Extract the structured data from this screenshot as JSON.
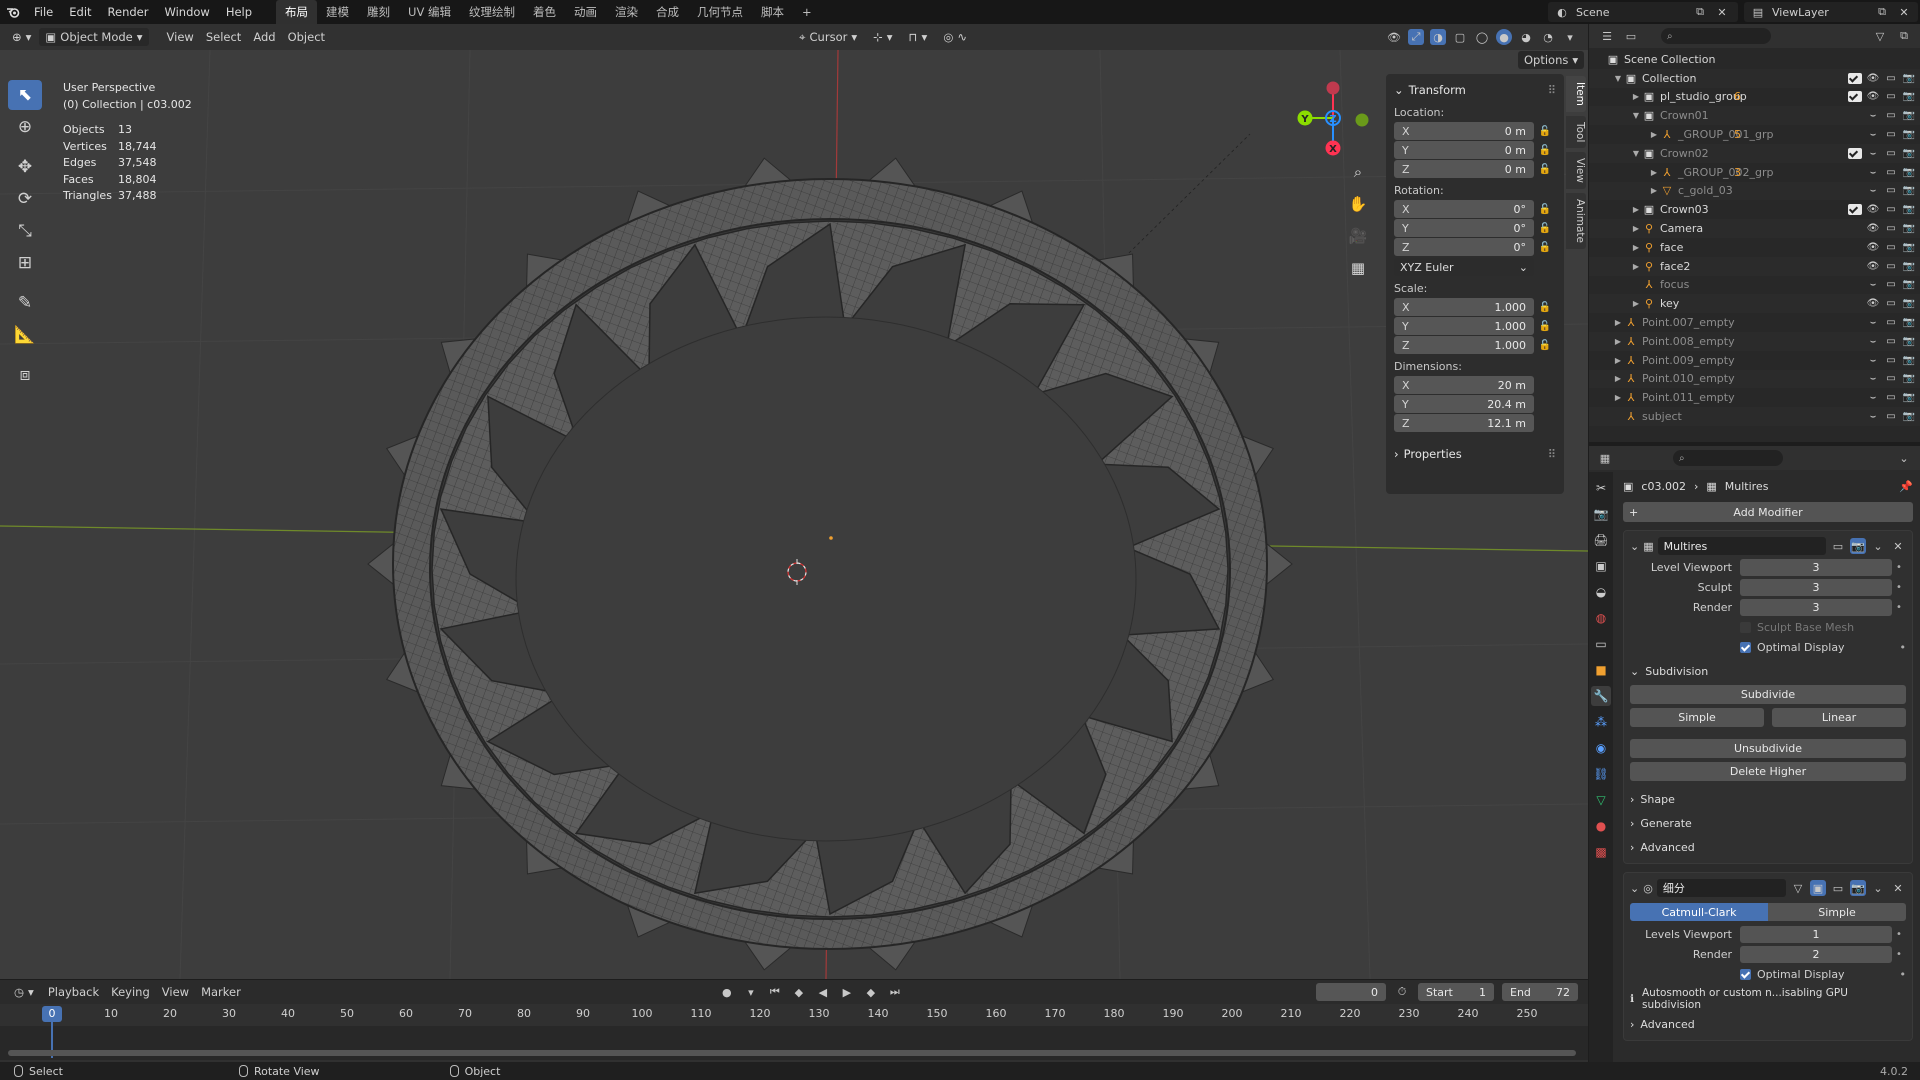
{
  "topbar": {
    "menus": [
      "File",
      "Edit",
      "Render",
      "Window",
      "Help"
    ],
    "workspaces": [
      "布局",
      "建模",
      "雕刻",
      "UV 编辑",
      "纹理绘制",
      "着色",
      "动画",
      "渲染",
      "合成",
      "几何节点",
      "脚本"
    ],
    "active_workspace": "布局",
    "add_tab": "+",
    "scene": "Scene",
    "view_layer": "ViewLayer"
  },
  "viewport": {
    "mode": "Object Mode",
    "menus": [
      "View",
      "Select",
      "Add",
      "Object"
    ],
    "pivot": "Cursor",
    "options": "Options",
    "info_title": "User Perspective",
    "info_sub": "(0) Collection | c03.002",
    "stats": [
      {
        "k": "Objects",
        "v": "13"
      },
      {
        "k": "Vertices",
        "v": "18,744"
      },
      {
        "k": "Edges",
        "v": "37,548"
      },
      {
        "k": "Faces",
        "v": "18,804"
      },
      {
        "k": "Triangles",
        "v": "37,488"
      }
    ],
    "gizmo_axes": {
      "x": "X",
      "y": "Y",
      "z": "Z"
    },
    "colors": {
      "x_axis": "#ff3352",
      "y_axis": "#8bdc00",
      "z_axis": "#2890ff"
    }
  },
  "npanel": {
    "tabs": [
      "Item",
      "Tool",
      "View",
      "Animate"
    ],
    "transform_title": "Transform",
    "location_label": "Location:",
    "location": [
      {
        "ax": "X",
        "v": "0 m"
      },
      {
        "ax": "Y",
        "v": "0 m"
      },
      {
        "ax": "Z",
        "v": "0 m"
      }
    ],
    "rotation_label": "Rotation:",
    "rotation": [
      {
        "ax": "X",
        "v": "0°"
      },
      {
        "ax": "Y",
        "v": "0°"
      },
      {
        "ax": "Z",
        "v": "0°"
      }
    ],
    "rotation_mode": "XYZ Euler",
    "scale_label": "Scale:",
    "scale": [
      {
        "ax": "X",
        "v": "1.000"
      },
      {
        "ax": "Y",
        "v": "1.000"
      },
      {
        "ax": "Z",
        "v": "1.000"
      }
    ],
    "dimensions_label": "Dimensions:",
    "dimensions": [
      {
        "ax": "X",
        "v": "20 m"
      },
      {
        "ax": "Y",
        "v": "20.4 m"
      },
      {
        "ax": "Z",
        "v": "12.1 m"
      }
    ],
    "properties_title": "Properties"
  },
  "timeline": {
    "menus": [
      "Playback",
      "Keying",
      "View",
      "Marker"
    ],
    "current_frame": "0",
    "start_label": "Start",
    "start": "1",
    "end_label": "End",
    "end": "72",
    "ticks": [
      "0",
      "10",
      "20",
      "30",
      "40",
      "50",
      "60",
      "70",
      "80",
      "90",
      "100",
      "110",
      "120",
      "130",
      "140",
      "150",
      "160",
      "170",
      "180",
      "190",
      "200",
      "210",
      "220",
      "230",
      "240",
      "250"
    ]
  },
  "statusbar": {
    "select": "Select",
    "rotate": "Rotate View",
    "object": "Object",
    "version": "4.0.2"
  },
  "outliner": {
    "rows": [
      {
        "name": "Scene Collection",
        "indent": 0,
        "icon": "scene-collection-icon",
        "tri": ""
      },
      {
        "name": "Collection",
        "indent": 1,
        "icon": "collection-icon",
        "tri": "▼"
      },
      {
        "name": "pl_studio_group",
        "indent": 2,
        "icon": "collection-icon",
        "tri": "▶"
      },
      {
        "name": "Crown01",
        "indent": 2,
        "icon": "collection-icon",
        "tri": "▼",
        "dim": true
      },
      {
        "name": "_GROUP_001_grp",
        "indent": 3,
        "icon": "empty-icon",
        "tri": "▶",
        "dim": true
      },
      {
        "name": "Crown02",
        "indent": 2,
        "icon": "collection-icon",
        "tri": "▼",
        "dim": true
      },
      {
        "name": "_GROUP_002_grp",
        "indent": 3,
        "icon": "empty-icon",
        "tri": "▶",
        "dim": true
      },
      {
        "name": "c_gold_03",
        "indent": 3,
        "icon": "mesh-icon",
        "tri": "▶",
        "dim": true
      },
      {
        "name": "Crown03",
        "indent": 2,
        "icon": "collection-icon",
        "tri": "▶"
      },
      {
        "name": "Camera",
        "indent": 2,
        "icon": "object-icon",
        "tri": "▶"
      },
      {
        "name": "face",
        "indent": 2,
        "icon": "object-icon",
        "tri": "▶"
      },
      {
        "name": "face2",
        "indent": 2,
        "icon": "object-icon",
        "tri": "▶"
      },
      {
        "name": "focus",
        "indent": 2,
        "icon": "empty-icon",
        "tri": "",
        "dim": true
      },
      {
        "name": "key",
        "indent": 2,
        "icon": "object-icon",
        "tri": "▶"
      },
      {
        "name": "Point.007_empty",
        "indent": 1,
        "icon": "empty-icon",
        "tri": "▶",
        "dim": true
      },
      {
        "name": "Point.008_empty",
        "indent": 1,
        "icon": "empty-icon",
        "tri": "▶",
        "dim": true
      },
      {
        "name": "Point.009_empty",
        "indent": 1,
        "icon": "empty-icon",
        "tri": "▶",
        "dim": true
      },
      {
        "name": "Point.010_empty",
        "indent": 1,
        "icon": "empty-icon",
        "tri": "▶",
        "dim": true
      },
      {
        "name": "Point.011_empty",
        "indent": 1,
        "icon": "empty-icon",
        "tri": "▶",
        "dim": true
      },
      {
        "name": "subject",
        "indent": 1,
        "icon": "empty-icon",
        "tri": "",
        "dim": true
      }
    ],
    "extras": [
      {
        "row": 2,
        "text": "6"
      },
      {
        "row": 4,
        "text": "5"
      },
      {
        "row": 6,
        "text": "3"
      }
    ]
  },
  "properties": {
    "object": "c03.002",
    "modifier_crumb": "Multires",
    "add_modifier": "Add Modifier",
    "multires": {
      "name": "Multires",
      "level_viewport_label": "Level Viewport",
      "level_viewport": "3",
      "sculpt_label": "Sculpt",
      "sculpt": "3",
      "render_label": "Render",
      "render": "3",
      "sculpt_base_mesh": "Sculpt Base Mesh",
      "optimal_display": "Optimal Display",
      "subdivision": "Subdivision",
      "subdivide": "Subdivide",
      "simple": "Simple",
      "linear": "Linear",
      "unsubdivide": "Unsubdivide",
      "delete_higher": "Delete Higher",
      "shape": "Shape",
      "generate": "Generate",
      "advanced": "Advanced"
    },
    "subsurf": {
      "name": "细分",
      "catmull": "Catmull-Clark",
      "simple": "Simple",
      "levels_viewport_label": "Levels Viewport",
      "levels_viewport": "1",
      "render_label": "Render",
      "render": "2",
      "optimal_display": "Optimal Display",
      "info": "Autosmooth or custom n...isabling GPU subdivision",
      "advanced": "Advanced"
    }
  }
}
